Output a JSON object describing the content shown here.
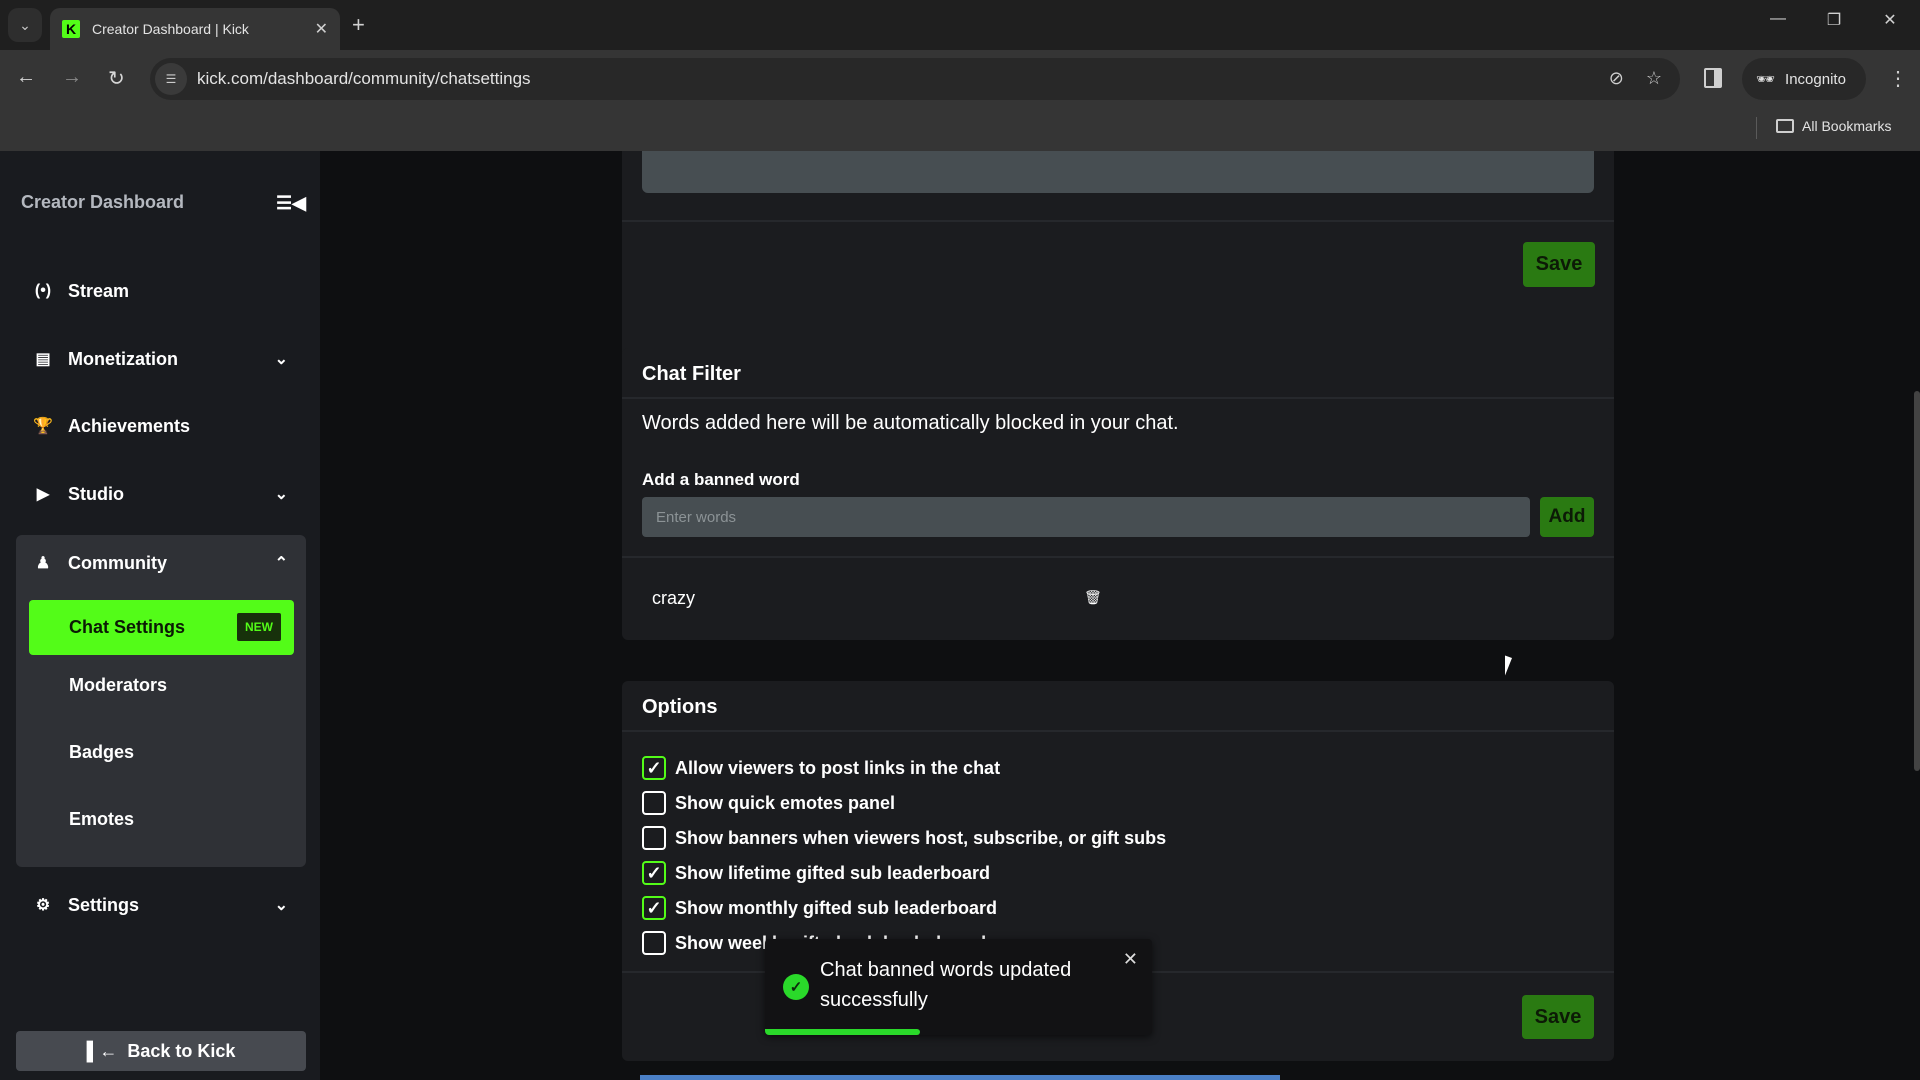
{
  "browser": {
    "tab_title": "Creator Dashboard | Kick",
    "tab_favicon": "K",
    "url": "kick.com/dashboard/community/chatsettings",
    "profile_label": "Incognito",
    "bookmarks_label": "All Bookmarks",
    "icons": {
      "tab_search": "chevron-down-icon",
      "new_tab": "plus-icon",
      "back": "arrow-left-icon",
      "forward": "arrow-right-icon",
      "reload": "reload-icon",
      "site_info": "tune-icon",
      "tracking": "eye-off-icon",
      "bookmark": "star-icon",
      "side_panel": "side-panel-icon",
      "menu": "more-vert-icon"
    }
  },
  "sidebar": {
    "title": "Creator Dashboard",
    "items": [
      {
        "label": "Stream",
        "icon": "broadcast-icon",
        "expandable": false
      },
      {
        "label": "Monetization",
        "icon": "chart-icon",
        "expandable": true
      },
      {
        "label": "Achievements",
        "icon": "trophy-icon",
        "expandable": false
      },
      {
        "label": "Studio",
        "icon": "video-icon",
        "expandable": true
      },
      {
        "label": "Community",
        "icon": "users-icon",
        "expandable": true,
        "expanded": true
      },
      {
        "label": "Settings",
        "icon": "gear-icon",
        "expandable": true
      }
    ],
    "community_subitems": [
      {
        "label": "Chat Settings",
        "active": true,
        "badge": "NEW"
      },
      {
        "label": "Moderators"
      },
      {
        "label": "Badges"
      },
      {
        "label": "Emotes"
      }
    ],
    "back_label": "Back to Kick"
  },
  "main": {
    "top_card": {
      "save_label": "Save"
    },
    "chat_filter": {
      "title": "Chat Filter",
      "description": "Words added here will be automatically blocked in your chat.",
      "input_label": "Add a banned word",
      "input_placeholder": "Enter words",
      "input_value": "",
      "add_label": "Add",
      "banned_words": [
        "crazy"
      ]
    },
    "options": {
      "title": "Options",
      "items": [
        {
          "label": "Allow viewers to post links in the chat",
          "checked": true
        },
        {
          "label": "Show quick emotes panel",
          "checked": false
        },
        {
          "label": "Show banners when viewers host, subscribe, or gift subs",
          "checked": false
        },
        {
          "label": "Show lifetime gifted sub leaderboard",
          "checked": true
        },
        {
          "label": "Show monthly gifted sub leaderboard",
          "checked": true
        },
        {
          "label": "Show weekly gifted sub leaderboard",
          "checked": false
        }
      ],
      "save_label": "Save"
    }
  },
  "toast": {
    "message": "Chat banned words updated successfully",
    "status": "success",
    "progress": 0.4
  },
  "colors": {
    "accent": "#53fc18",
    "button_green": "#2a7a12",
    "card_bg": "#1b1c1f",
    "sidebar_bg": "#191b1f",
    "success": "#2ad92a"
  }
}
